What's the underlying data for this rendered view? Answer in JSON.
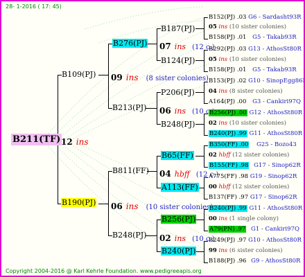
{
  "header": {
    "date": "28- 1-2016 ( 17: 45)"
  },
  "footer": {
    "copyright": "Copyright 2004-2016 @ Karl Kehrle Foundation.   www.pedigreeapis.org"
  },
  "root": {
    "id": "B211(TF)",
    "gen_num": "12",
    "gen_ins": "ins"
  },
  "g1": {
    "top": {
      "id": "B109(PJ)",
      "gen_num": "09",
      "gen_ins": "ins",
      "sisters": "(8 sister colonies)"
    },
    "bottom": {
      "id": "B190(PJ)",
      "gen_num": "06",
      "gen_ins": "ins",
      "sisters": "(10 sister colonies)"
    }
  },
  "g2": {
    "a": {
      "id": "B276(PJ)",
      "gen_num": "07",
      "gen_ins": "ins",
      "sisters": "(12 c.)"
    },
    "b": {
      "id": "B213(PJ)",
      "gen_num": "06",
      "gen_ins": "ins",
      "sisters": "(10 c.)"
    },
    "c": {
      "id": "B811(FF)",
      "gen_num": "04",
      "gen_ins": "hbff",
      "sisters": "(12 c.)"
    },
    "d": {
      "id": "B248(PJ)",
      "gen_num": "02",
      "gen_ins": "ins",
      "sisters": "(10 c.)"
    }
  },
  "g3": {
    "a1": {
      "id": "B187(PJ)",
      "gen_num": "05",
      "gen_ins": "ins",
      "sisters": "(10 sister colonies)"
    },
    "a2": {
      "id": "B124(PJ)",
      "gen_num": "05",
      "gen_ins": "ins",
      "sisters": "(10 sister colonies)"
    },
    "b1": {
      "id": "P206(PJ)",
      "gen_num": "04",
      "gen_ins": "ins",
      "sisters": "(8 sister colonies)"
    },
    "b2": {
      "id": "B248(PJ)",
      "gen_num": "02",
      "gen_ins": "ins",
      "sisters": "(10 sister colonies)"
    },
    "c1": {
      "id": "B65(FF)",
      "gen_num": "02",
      "gen_ins": "hbff",
      "sisters": "(12 sister colonies)"
    },
    "c2": {
      "id": "A113(FF)",
      "gen_num": "00",
      "gen_ins": "hbff",
      "sisters": "(12 sister colonies)"
    },
    "d1": {
      "id": "B256(PJ)",
      "gen_num": "00",
      "gen_ins": "ins",
      "sisters": "(1 single colony)"
    },
    "d2": {
      "id": "B240(PJ)",
      "gen_num": "99",
      "gen_ins": "ins",
      "sisters": "(6 sister colonies)"
    }
  },
  "g4": [
    {
      "id": "B152(PJ)",
      "year": ".03",
      "breeder": "G6 - Sardasht93R"
    },
    {
      "id": "B158(PJ)",
      "year": ".01",
      "breeder": "G5 - Takab93R"
    },
    {
      "id": "B292(PJ)",
      "year": ".03",
      "breeder": "G13 - AthosSt80R"
    },
    {
      "id": "B158(PJ)",
      "year": ".01",
      "breeder": "G5 - Takab93R"
    },
    {
      "id": "B153(PJ)",
      "year": ".02",
      "breeder": "G10 - SinopEgg86R"
    },
    {
      "id": "A164(PJ)",
      "year": ".00",
      "breeder": "G3 - Cankiri97Q"
    },
    {
      "id": "B256(PJ)",
      "year": ".00",
      "breeder": "G12 - AthosSt80R"
    },
    {
      "id": "B240(PJ)",
      "year": ".99",
      "breeder": "G11 - AthosSt80R"
    },
    {
      "id": "B350(FF)",
      "year": ".00",
      "breeder": "G25 - Bozo43"
    },
    {
      "id": "B155(FF)",
      "year": ".98",
      "breeder": "G17 - Sinop62R"
    },
    {
      "id": "A775(FF)",
      "year": ".98",
      "breeder": "G19 - Sinop62R"
    },
    {
      "id": "B137(FF)",
      "year": ".97",
      "breeder": "G17 - Sinop62R"
    },
    {
      "id": "B240(PJ)",
      "year": ".99",
      "breeder": "G11 - AthosSt80R"
    },
    {
      "id": "A79(PN)",
      "year": ".97",
      "breeder": "G1 - Cankiri97Q"
    },
    {
      "id": "B249(PJ)",
      "year": ".97",
      "breeder": "G10 - AthosSt80R"
    },
    {
      "id": "B188(PJ)",
      "year": ".96",
      "breeder": "G9 - AthosSt80R"
    }
  ]
}
